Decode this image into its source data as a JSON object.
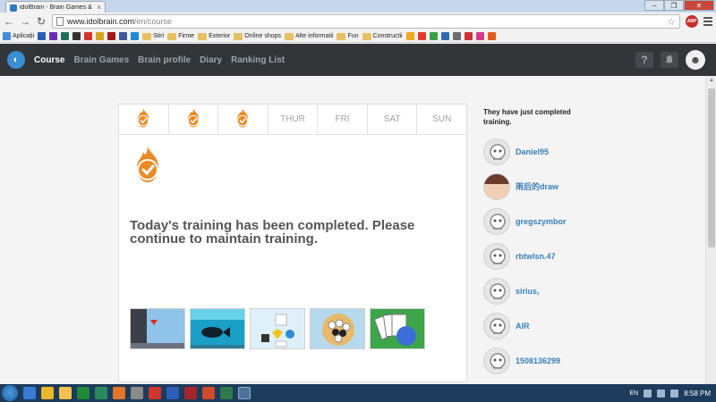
{
  "browser": {
    "tab_title": "idolBrain - Brain Games &",
    "tab_close": "×",
    "window_controls": [
      "–",
      "❐",
      "✕"
    ],
    "url_host": "www.idolbrain.com",
    "url_path": "/en/course",
    "adblock_label": "ABP",
    "bookmarks": [
      {
        "label": "Aplicații",
        "type": "apps",
        "color": "#4a8ad4"
      },
      {
        "label": "",
        "type": "site",
        "color": "#2b5fb5"
      },
      {
        "label": "",
        "type": "site",
        "color": "#6a2bb5"
      },
      {
        "label": "",
        "type": "site",
        "color": "#1e6e5a"
      },
      {
        "label": "",
        "type": "site",
        "color": "#333333"
      },
      {
        "label": "",
        "type": "site",
        "color": "#d1342c"
      },
      {
        "label": "",
        "type": "site",
        "color": "#d9a21b"
      },
      {
        "label": "",
        "type": "site",
        "color": "#a01818"
      },
      {
        "label": "",
        "type": "site",
        "color": "#3b5998"
      },
      {
        "label": "",
        "type": "site",
        "color": "#1f8ad4"
      },
      {
        "label": "Stiri",
        "type": "folder"
      },
      {
        "label": "Firme",
        "type": "folder"
      },
      {
        "label": "Exterior",
        "type": "folder"
      },
      {
        "label": "Online shops",
        "type": "folder"
      },
      {
        "label": "Alte informatii",
        "type": "folder"
      },
      {
        "label": "Fun",
        "type": "folder"
      },
      {
        "label": "Constructii",
        "type": "folder"
      },
      {
        "label": "",
        "type": "site",
        "color": "#f0a81e"
      },
      {
        "label": "",
        "type": "site",
        "color": "#e03a2a"
      },
      {
        "label": "",
        "type": "site",
        "color": "#3aa04a"
      },
      {
        "label": "",
        "type": "site",
        "color": "#2d6bb0"
      },
      {
        "label": "",
        "type": "site",
        "color": "#6d6d6d"
      },
      {
        "label": "",
        "type": "site",
        "color": "#cf3030"
      },
      {
        "label": "",
        "type": "site",
        "color": "#d33a8a"
      },
      {
        "label": "",
        "type": "site",
        "color": "#e35d1e"
      }
    ]
  },
  "site": {
    "nav": [
      {
        "label": "Course",
        "active": true
      },
      {
        "label": "Brain Games",
        "active": false
      },
      {
        "label": "Brain profile",
        "active": false
      },
      {
        "label": "Diary",
        "active": false
      },
      {
        "label": "Ranking List",
        "active": false
      }
    ],
    "help_label": "?",
    "bell_label": "🔔",
    "avatar_label": "☻"
  },
  "course": {
    "days": [
      {
        "label": "",
        "completed": true
      },
      {
        "label": "",
        "completed": true
      },
      {
        "label": "",
        "completed": true
      },
      {
        "label": "THUR",
        "completed": false
      },
      {
        "label": "FRI",
        "completed": false
      },
      {
        "label": "SAT",
        "completed": false
      },
      {
        "label": "SUN",
        "completed": false
      }
    ],
    "message": "Today's training has been completed. Please continue to maintain training.",
    "games": [
      {
        "name": "cliff-game"
      },
      {
        "name": "fish-game"
      },
      {
        "name": "shapes-game"
      },
      {
        "name": "go-game"
      },
      {
        "name": "cards-game"
      }
    ]
  },
  "sidebar": {
    "title": "They have just completed training.",
    "users": [
      {
        "name": "Daniel95",
        "photo": false
      },
      {
        "name": "雨后的draw",
        "photo": true
      },
      {
        "name": "gregszymbor",
        "photo": false
      },
      {
        "name": "rbtwlsn.47",
        "photo": false
      },
      {
        "name": "sirius,",
        "photo": false
      },
      {
        "name": "AIR",
        "photo": false
      },
      {
        "name": "1508136299",
        "photo": false
      }
    ]
  },
  "taskbar": {
    "apps": [
      "ie",
      "chrome",
      "explorer",
      "excel",
      "publisher",
      "outlook",
      "calculator",
      "acrobat",
      "word",
      "access",
      "powerpoint",
      "project",
      "browser-active"
    ],
    "language": "EN",
    "time": "8:58 PM"
  },
  "colors": {
    "accent": "#e98a26",
    "header": "#323639",
    "link": "#3a7fb8"
  }
}
